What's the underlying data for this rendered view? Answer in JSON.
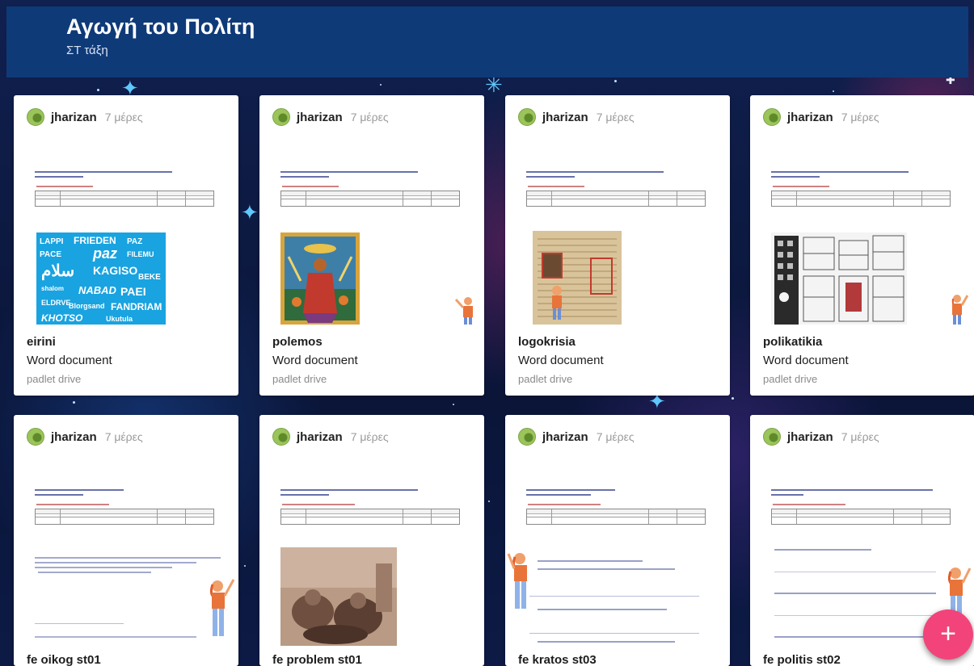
{
  "header": {
    "title": "Αγωγή του Πολίτη",
    "subtitle": "ΣΤ τάξη"
  },
  "cards": [
    {
      "author": "jharizan",
      "age": "7 μέρες",
      "title": "eirini",
      "type": "Word document",
      "source": "padlet drive",
      "picture": "peace-words-collage"
    },
    {
      "author": "jharizan",
      "age": "7 μέρες",
      "title": "polemos",
      "type": "Word document",
      "source": "padlet drive",
      "picture": "war-illustration"
    },
    {
      "author": "jharizan",
      "age": "7 μέρες",
      "title": "logokrisia",
      "type": "Word document",
      "source": "padlet drive",
      "picture": "censored-newspaper"
    },
    {
      "author": "jharizan",
      "age": "7 μέρες",
      "title": "polikatikia",
      "type": "Word document",
      "source": "padlet drive",
      "picture": "apartment-buildings-sketch"
    },
    {
      "author": "jharizan",
      "age": "7 μέρες",
      "title": "fe oikog st01",
      "type": "",
      "source": "",
      "picture": "worksheet-text"
    },
    {
      "author": "jharizan",
      "age": "7 μέρες",
      "title": "fe problem st01",
      "type": "",
      "source": "",
      "picture": "sepia-photo"
    },
    {
      "author": "jharizan",
      "age": "7 μέρες",
      "title": "fe kratos st03",
      "type": "",
      "source": "",
      "picture": "worksheet-text"
    },
    {
      "author": "jharizan",
      "age": "7 μέρες",
      "title": "fe politis st02",
      "type": "",
      "source": "",
      "picture": "worksheet-text"
    }
  ],
  "fab": {
    "icon": "plus-icon",
    "label": "+"
  },
  "colors": {
    "header_bg": "#0f3a78",
    "fab": "#f2447a",
    "background": "#0b1740"
  }
}
